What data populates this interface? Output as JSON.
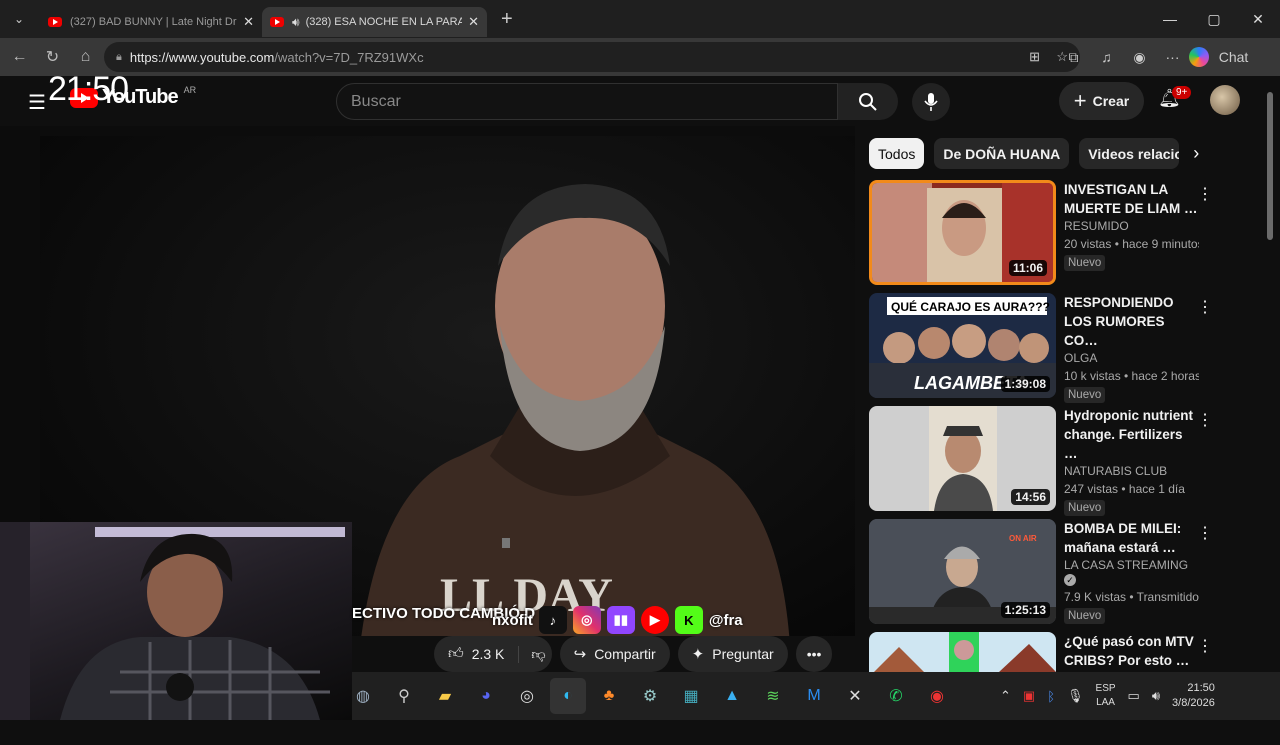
{
  "browser": {
    "tabs": [
      {
        "title": "(327) BAD BUNNY | Late Night Dri…",
        "close": "✕"
      },
      {
        "title": "(328) ESA NOCHE EN LA PARA…",
        "close": "✕"
      }
    ],
    "new_tab": "+",
    "url_host": "https://www.youtube.com",
    "url_path": "/watch?v=7D_7RZ91WXc",
    "copilot_label": "Chat",
    "window_controls": [
      "—",
      "▢",
      "✕"
    ]
  },
  "overlay_clock": "21:50",
  "youtube": {
    "logo_text": "YouTube",
    "country": "AR",
    "search_placeholder": "Buscar",
    "create_label": "Crear",
    "notif_badge": "9+"
  },
  "video": {
    "caption": "ECTIVO TODO CAMBIÓ D",
    "handle_left": "nxofit",
    "handle_right": "@fra",
    "shirt_text": "LL DAY"
  },
  "actions": {
    "likes": "2.3 K",
    "share": "Compartir",
    "ask": "Preguntar",
    "more": "•••"
  },
  "chips": [
    "Todos",
    "De DOÑA HUANA",
    "Videos relacio"
  ],
  "recommendations": [
    {
      "title": "INVESTIGAN LA MUERTE DE LIAM …",
      "channel": "RESUMIDO",
      "views": "20 vistas • hace 9 minutos",
      "badge": "Nuevo",
      "duration": "11:06"
    },
    {
      "title": "RESPONDIENDO LOS RUMORES CO…",
      "channel": "OLGA",
      "views": "10 k vistas • hace 2 horas",
      "badge": "Nuevo",
      "duration": "1:39:08",
      "thumb_top": "QUÉ CARAJO ES AURA???",
      "thumb_bottom": "LAGAMBETA"
    },
    {
      "title": "Hydroponic nutrient change. Fertilizers …",
      "channel": "NATURABIS CLUB",
      "views": "247 vistas • hace 1 día",
      "badge": "Nuevo",
      "duration": "14:56"
    },
    {
      "title": "BOMBA DE MILEI: mañana estará …",
      "channel": "LA CASA STREAMING",
      "views": "7.9 K vistas • Transmitido …",
      "badge": "Nuevo",
      "duration": "1:25:13",
      "verified": "✓",
      "thumb_tag": "ON AIR"
    },
    {
      "title": "¿Qué pasó con MTV CRIBS? Por esto …",
      "channel": "",
      "views": "",
      "badge": "",
      "duration": ""
    }
  ],
  "taskbar": {
    "lang_top": "ESP",
    "lang_bottom": "LAA",
    "time": "21:50",
    "date": "3/8/2026"
  }
}
